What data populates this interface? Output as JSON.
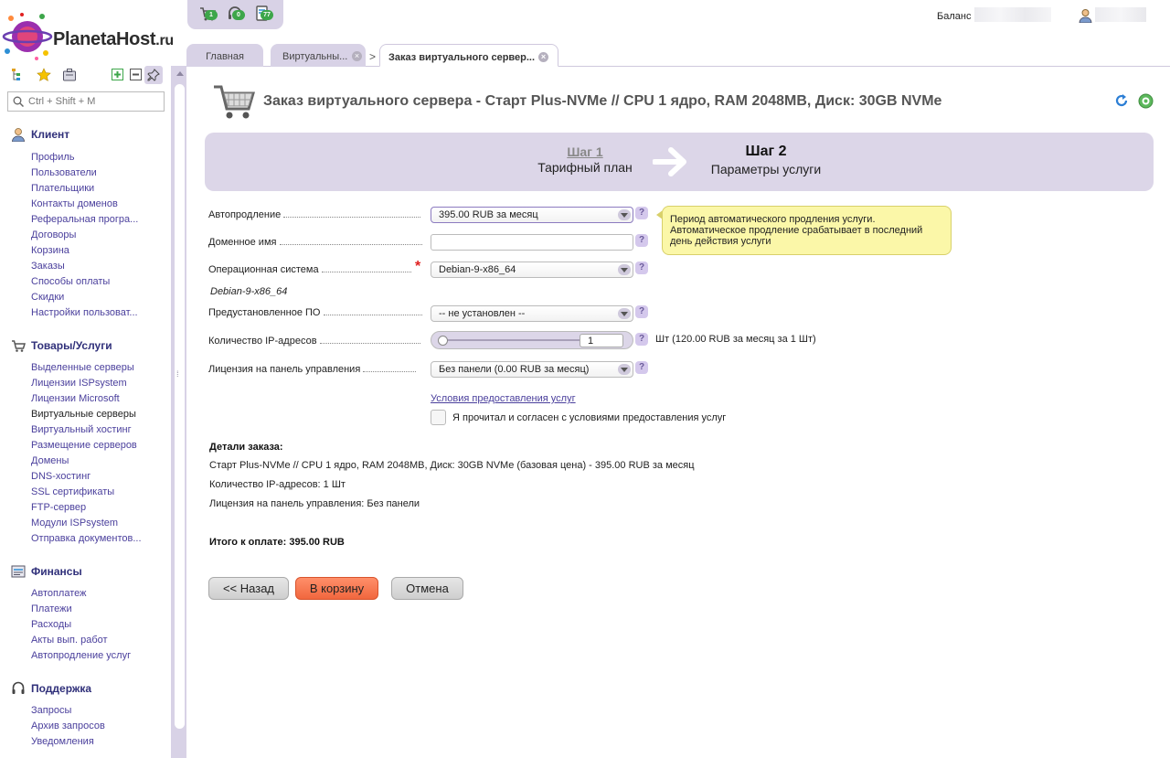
{
  "header": {
    "logo_text": "PlanetaHost",
    "logo_suffix": ".ru",
    "quickbar": [
      {
        "name": "cart-icon",
        "badge": "1"
      },
      {
        "name": "headset-icon",
        "badge": "0"
      },
      {
        "name": "document-icon",
        "badge": "77"
      }
    ],
    "balance_label": "Баланс"
  },
  "tabs": [
    {
      "label": "Главная"
    },
    {
      "label": "Виртуальны..."
    },
    {
      "label": "Заказ виртуального сервер..."
    }
  ],
  "sidebar": {
    "search_placeholder": "Ctrl + Shift + M",
    "groups": [
      {
        "title": "Клиент",
        "icon": "user-icon",
        "items": [
          "Профиль",
          "Пользователи",
          "Плательщики",
          "Контакты доменов",
          "Реферальная програ...",
          "Договоры",
          "Корзина",
          "Заказы",
          "Способы оплаты",
          "Скидки",
          "Настройки пользоват..."
        ]
      },
      {
        "title": "Товары/Услуги",
        "icon": "cart-icon",
        "items": [
          "Выделенные серверы",
          "Лицензии ISPsystem",
          "Лицензии Microsoft",
          "Виртуальные серверы",
          "Виртуальный хостинг",
          "Размещение серверов",
          "Домены",
          "DNS-хостинг",
          "SSL сертификаты",
          "FTP-сервер",
          "Модули ISPsystem",
          "Отправка документов..."
        ]
      },
      {
        "title": "Финансы",
        "icon": "finance-icon",
        "items": [
          "Автоплатеж",
          "Платежи",
          "Расходы",
          "Акты вып. работ",
          "Автопродление услуг"
        ]
      },
      {
        "title": "Поддержка",
        "icon": "headset-icon",
        "items": [
          "Запросы",
          "Архив запросов",
          "Уведомления"
        ]
      }
    ]
  },
  "page": {
    "title": "Заказ виртуального сервера - Старт Plus-NVMe // CPU 1 ядро, RAM 2048MB, Диск: 30GB NVMe"
  },
  "steps": {
    "step1_num": "Шаг 1",
    "step1_label": "Тарифный план",
    "step2_num": "Шаг 2",
    "step2_label": "Параметры услуги"
  },
  "form": {
    "autorenew_label": "Автопродление",
    "autorenew_value": "395.00 RUB за месяц",
    "domain_label": "Доменное имя",
    "domain_value": "",
    "os_label": "Операционная система",
    "os_required": "*",
    "os_value": "Debian-9-x86_64",
    "os_note": "Debian-9-x86_64",
    "preinstalled_label": "Предустановленное ПО",
    "preinstalled_value": "-- не установлен --",
    "ip_label": "Количество IP-адресов",
    "ip_value": "1",
    "ip_slider_fraction": 0,
    "ip_note": "Шт (120.00 RUB за месяц за 1 Шт)",
    "license_label": "Лицензия на панель управления",
    "license_value": "Без панели (0.00 RUB за месяц)",
    "help_mark": "?",
    "tooltip_line1": "Период автоматического продления услуги.",
    "tooltip_line2": "Автоматическое продление срабатывает в последний",
    "tooltip_line3": "день действия услуги",
    "terms_link": "Условия предоставления услуг",
    "terms_checkbox": "Я прочитал и согласен с условиями предоставления услуг"
  },
  "details": {
    "title": "Детали заказа:",
    "lines": [
      "Старт Plus-NVMe // CPU 1 ядро, RAM 2048MB, Диск: 30GB NVMe (базовая цена) - 395.00 RUB за месяц",
      "Количество IP-адресов: 1 Шт",
      "Лицензия на панель управления: Без панели"
    ],
    "total": "Итого к оплате: 395.00 RUB"
  },
  "buttons": {
    "back": "<< Назад",
    "cart": "В корзину",
    "cancel": "Отмена"
  },
  "colors": {
    "accent": "#d8d2e6",
    "link": "#4a3f9c",
    "primary_button": "#f1673e",
    "tooltip_bg": "#fbf7a8"
  }
}
